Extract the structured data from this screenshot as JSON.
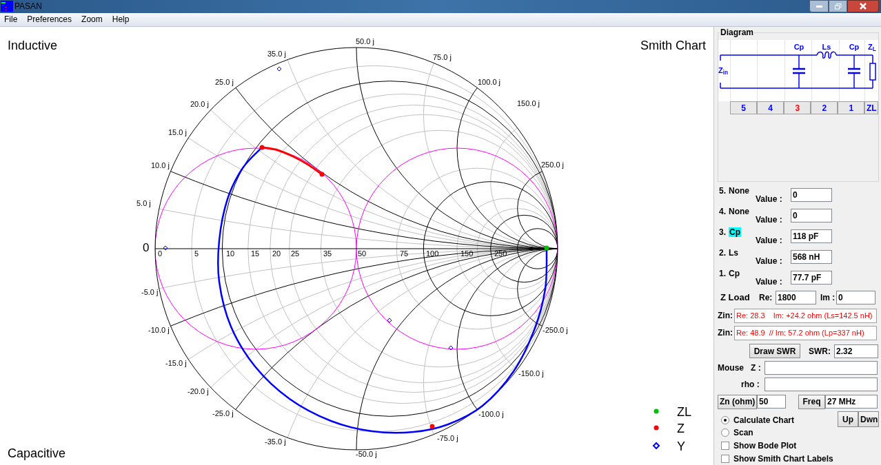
{
  "window": {
    "title": "PASAN"
  },
  "menu": [
    "File",
    "Preferences",
    "Zoom",
    "Help"
  ],
  "chart": {
    "top_left": "Inductive",
    "top_right": "Smith Chart",
    "bottom_left": "Capacitive",
    "origin_label": "0",
    "resistance_labels": [
      "0",
      "5",
      "10",
      "15",
      "20",
      "25",
      "35",
      "50",
      "75",
      "100",
      "150",
      "250"
    ],
    "reactance_labels_positive": [
      "5.0 j",
      "10.0 j",
      "15.0 j",
      "20.0 j",
      "25.0 j",
      "35.0 j",
      "50.0 j",
      "75.0 j",
      "100.0 j",
      "150.0 j",
      "250.0 j"
    ],
    "reactance_labels_negative": [
      "-5.0 j",
      "-10.0 j",
      "-15.0 j",
      "-20.0 j",
      "-25.0 j",
      "-35.0 j",
      "-50.0 j",
      "-75.0 j",
      "-100.0 j",
      "-150.0 j",
      "-250.0 j"
    ],
    "legend": [
      {
        "label": "ZL",
        "kind": "dot",
        "color": "#00c000"
      },
      {
        "label": "Z",
        "kind": "dot",
        "color": "#ff0000"
      },
      {
        "label": "Y",
        "kind": "diamond",
        "color": "#0000ff"
      }
    ]
  },
  "diagram": {
    "title": "Diagram",
    "input_label": "Z$_{in}$",
    "load_label": "Z$_{L}$",
    "elements": [
      {
        "kind": "none"
      },
      {
        "kind": "none"
      },
      {
        "kind": "shunt_c",
        "label": "Cp"
      },
      {
        "kind": "series_l",
        "label": "Ls"
      },
      {
        "kind": "shunt_c",
        "label": "Cp"
      }
    ],
    "positions": [
      {
        "label": "5",
        "selected": false
      },
      {
        "label": "4",
        "selected": false
      },
      {
        "label": "3",
        "selected": true
      },
      {
        "label": "2",
        "selected": false
      },
      {
        "label": "1",
        "selected": false
      },
      {
        "label": "ZL",
        "selected": false
      }
    ]
  },
  "components": [
    {
      "number": "5.",
      "name": "None",
      "value_label": "Value :",
      "value": "0",
      "selected": false
    },
    {
      "number": "4.",
      "name": "None",
      "value_label": "Value :",
      "value": "0",
      "selected": false
    },
    {
      "number": "3.",
      "name": "Cp",
      "value_label": "Value :",
      "value": "118 pF",
      "selected": true
    },
    {
      "number": "2.",
      "name": "Ls",
      "value_label": "Value :",
      "value": "568 nH",
      "selected": false
    },
    {
      "number": "1.",
      "name": "Cp",
      "value_label": "Value :",
      "value": "77.7 pF",
      "selected": false
    }
  ],
  "z_load": {
    "label": "Z Load",
    "re_label": "Re:",
    "re": "1800",
    "im_label": "Im :",
    "im": "0"
  },
  "zin": [
    {
      "label": "Zin:",
      "value": "Re: 28.3    Im: +24.2 ohm (Ls=142.5 nH)"
    },
    {
      "label": "Zin:",
      "value": "Re: 48.9  // Im: 57.2 ohm (Lp=337 nH)"
    }
  ],
  "swr": {
    "button": "Draw SWR",
    "label": "SWR:",
    "value": "2.32"
  },
  "mouse": {
    "label": "Mouse",
    "z_label": "Z :",
    "rho_label": "rho :"
  },
  "zn": {
    "button": "Zn (ohm)",
    "value": "50"
  },
  "freq": {
    "button": "Freq",
    "value": "27 MHz"
  },
  "step_buttons": [
    "Up",
    "Dwn"
  ],
  "modes": [
    {
      "label": "Calculate Chart",
      "selected": true
    },
    {
      "label": "Scan",
      "selected": false
    }
  ],
  "options": [
    {
      "label": "Show Bode Plot",
      "checked": false
    },
    {
      "label": "Show Smith Chart Labels",
      "checked": false
    }
  ]
}
